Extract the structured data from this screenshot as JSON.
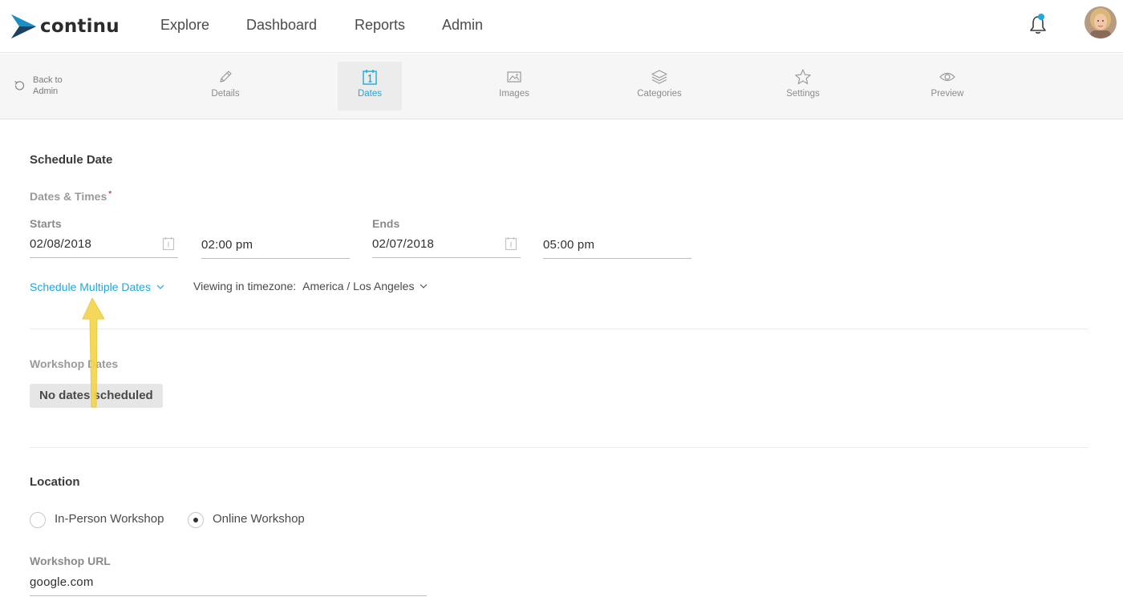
{
  "brand": {
    "name": "continu"
  },
  "nav": {
    "items": [
      {
        "label": "Explore"
      },
      {
        "label": "Dashboard"
      },
      {
        "label": "Reports"
      },
      {
        "label": "Admin"
      }
    ]
  },
  "toolbar": {
    "back_label": "Back to Admin",
    "tabs": [
      {
        "label": "Details",
        "icon": "pencil-icon"
      },
      {
        "label": "Dates",
        "icon": "calendar-icon",
        "active": true
      },
      {
        "label": "Images",
        "icon": "image-icon"
      },
      {
        "label": "Categories",
        "icon": "layers-icon"
      },
      {
        "label": "Settings",
        "icon": "star-icon"
      },
      {
        "label": "Preview",
        "icon": "eye-icon"
      }
    ]
  },
  "schedule": {
    "title": "Schedule Date",
    "dates_times_label": "Dates & Times",
    "required_mark": "*",
    "starts_label": "Starts",
    "ends_label": "Ends",
    "start_date": "02/08/2018",
    "start_time": "02:00 pm",
    "end_date": "02/07/2018",
    "end_time": "05:00 pm",
    "multiple_dates_link": "Schedule Multiple Dates",
    "timezone_label": "Viewing in timezone:",
    "timezone_value": "America / Los Angeles"
  },
  "workshop": {
    "label": "Workshop Dates",
    "empty_text": "No dates scheduled"
  },
  "location": {
    "title": "Location",
    "options": [
      {
        "label": "In-Person Workshop",
        "selected": false
      },
      {
        "label": "Online Workshop",
        "selected": true
      }
    ],
    "url_label": "Workshop URL",
    "url_value": "google.com"
  },
  "colors": {
    "accent": "#1ea7e0",
    "annotation_arrow": "#f2d54e"
  }
}
